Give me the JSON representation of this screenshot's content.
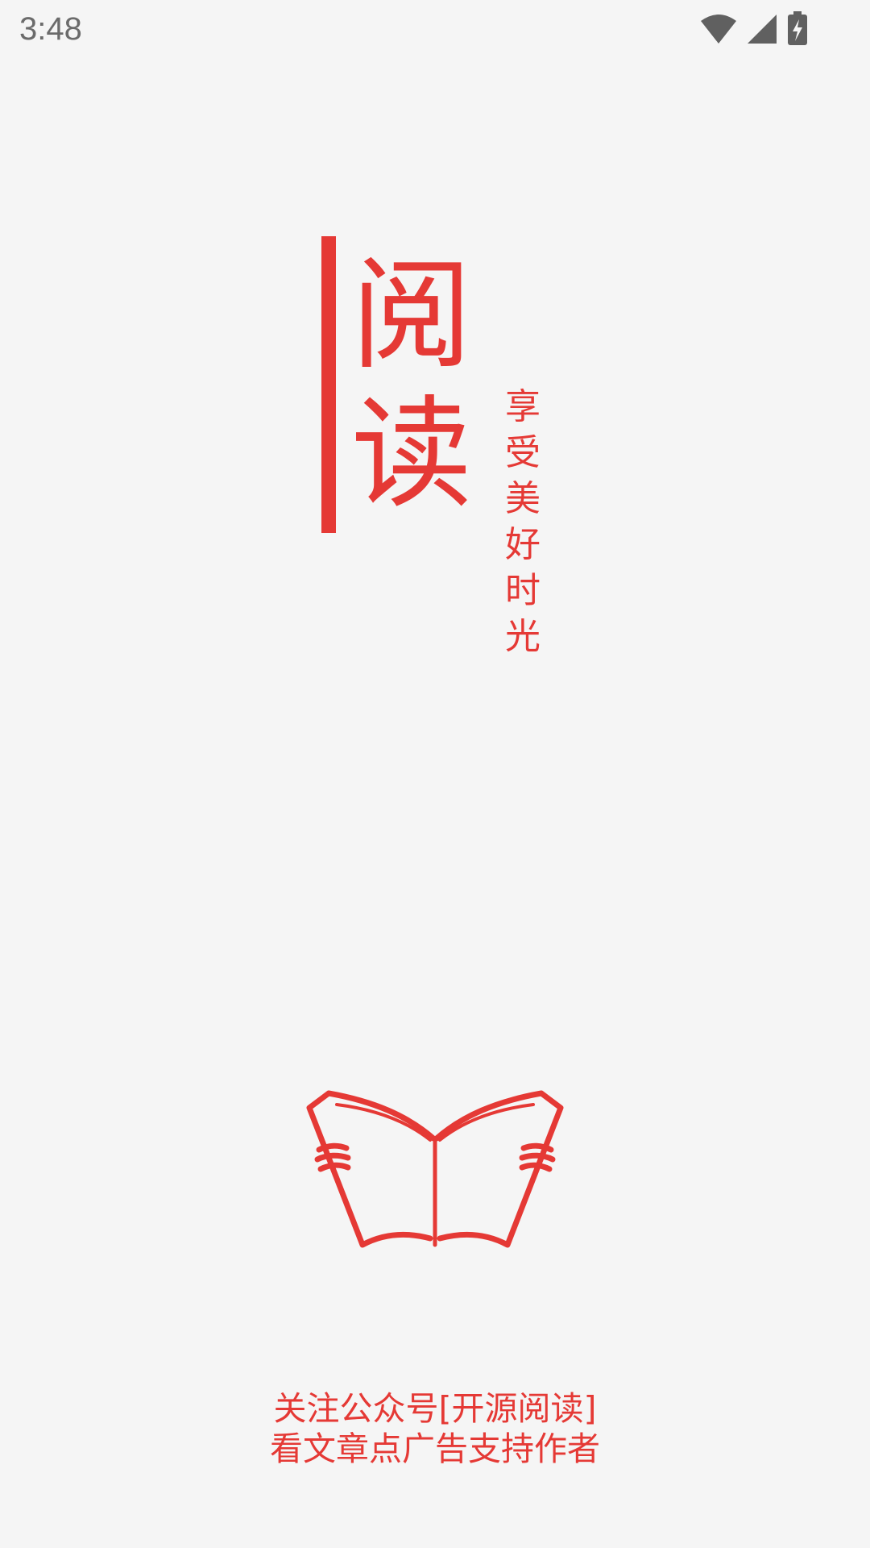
{
  "status_bar": {
    "time": "3:48",
    "icons": [
      "wifi-icon",
      "cell-signal-icon",
      "battery-charging-icon"
    ],
    "icon_color": "#606060"
  },
  "brand": {
    "title_chars": [
      "阅",
      "读"
    ],
    "slogan_chars": [
      "享",
      "受",
      "美",
      "好",
      "时",
      "光"
    ],
    "accent_color": "#e53935",
    "logo_icon": "open-book-icon"
  },
  "footer": {
    "line1": "关注公众号[开源阅读]",
    "line2": "看文章点广告支持作者"
  },
  "colors": {
    "background": "#f5f5f5",
    "accent": "#e53935"
  }
}
